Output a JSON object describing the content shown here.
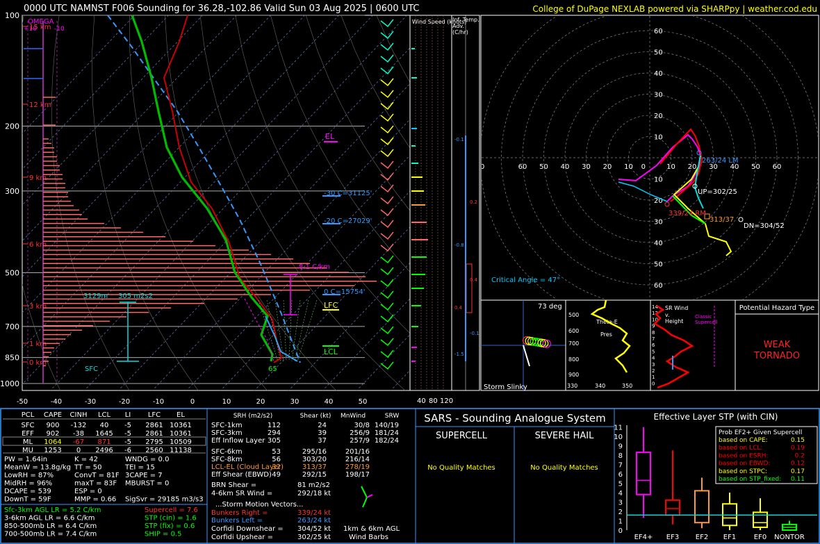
{
  "header": {
    "title": "0000 UTC NAMNST F006 Sounding for 36.28,-102.86 Valid  Sun 03 Aug 2025 | 0600 UTC",
    "credit": "College of DuPage NEXLAB powered via SHARPpy | weather.cod.edu"
  },
  "skewt": {
    "pressure_ticks": [
      "100",
      "200",
      "300",
      "500",
      "700",
      "850",
      "1000"
    ],
    "temp_ticks": [
      "-50",
      "-40",
      "-30",
      "-20",
      "-10",
      "0",
      "10",
      "20",
      "30",
      "40",
      "50"
    ],
    "height_labels": [
      "15 km",
      "12 km",
      "9 km",
      "6 km",
      "3 km",
      "1 km",
      "0 km"
    ],
    "omega_label": "OMEGA",
    "omega_left": "+10",
    "omega_right": "-10",
    "el_label": "EL",
    "lfc_label": "LFC",
    "lcl_label": "LCL",
    "lapse_label": "8.1 C/km",
    "m30_label": "-30 C=31125'",
    "m20_label": "-20 C=27029'",
    "zero_label": "0 C=15754'",
    "sfc_label": "SFC",
    "depth_label": "3129m",
    "srh_label": "305 m2s2",
    "sfc_value": "65",
    "omega_profile": [
      2,
      3,
      4,
      4,
      5,
      5,
      6,
      6,
      7,
      7,
      8,
      8,
      9,
      9,
      10,
      11,
      13,
      14,
      16,
      22,
      28,
      36,
      44,
      54,
      62,
      74,
      82,
      90,
      96,
      102,
      110,
      116,
      120,
      112,
      96,
      82,
      70,
      58,
      46,
      38,
      30,
      24,
      18,
      14,
      10,
      8,
      6,
      4,
      3,
      2,
      2,
      1
    ],
    "temp_profile": [
      [
        100,
        -5
      ],
      [
        150,
        -30
      ],
      [
        200,
        -26
      ],
      [
        250,
        -17
      ],
      [
        300,
        -8
      ],
      [
        350,
        -1
      ],
      [
        400,
        5
      ],
      [
        450,
        10
      ],
      [
        500,
        13
      ],
      [
        550,
        16
      ],
      [
        600,
        18
      ],
      [
        650,
        20
      ],
      [
        700,
        21
      ],
      [
        750,
        22
      ],
      [
        800,
        22
      ],
      [
        850,
        26
      ],
      [
        875,
        27
      ]
    ],
    "dew_profile": [
      [
        100,
        -25
      ],
      [
        150,
        -33
      ],
      [
        200,
        -32
      ],
      [
        250,
        -24
      ],
      [
        300,
        -14
      ],
      [
        350,
        -5
      ],
      [
        400,
        0
      ],
      [
        450,
        4
      ],
      [
        500,
        9
      ],
      [
        550,
        13
      ],
      [
        600,
        15
      ],
      [
        650,
        18
      ],
      [
        700,
        20
      ],
      [
        750,
        20
      ],
      [
        800,
        20
      ],
      [
        850,
        24
      ],
      [
        875,
        24
      ]
    ],
    "parcel_profile": [
      [
        875,
        27
      ],
      [
        800,
        24
      ],
      [
        700,
        20
      ],
      [
        600,
        15
      ],
      [
        500,
        6
      ],
      [
        400,
        -7
      ],
      [
        300,
        -20
      ],
      [
        250,
        -30
      ],
      [
        200,
        -36
      ],
      [
        150,
        -50
      ],
      [
        100,
        -70
      ]
    ]
  },
  "wind_speed_panel": {
    "title": "Wind Speed (knots)",
    "ticks": [
      "40",
      "80",
      "120"
    ]
  },
  "inferred_temp_panel": {
    "title": "Inf. Temp. Adv. (C/hr)",
    "values": [
      "-0.1",
      "0.2",
      "-0.8",
      "0.4",
      "0.4",
      "-0.1",
      "-1.5"
    ]
  },
  "hodograph": {
    "ring_labels": [
      "60",
      "50",
      "40",
      "30",
      "20",
      "10"
    ],
    "lm_label": "263/24 LM",
    "up_label": "UP=302/25",
    "rm_label": "339/24 RM",
    "mean_label": "313/37",
    "dn_label": "DN=304/52",
    "critical_angle": "Critical Angle = 47°"
  },
  "slinky": {
    "angle": "73 deg",
    "label": "Storm Slinky"
  },
  "theta": {
    "label1": "Theta-E",
    "label2": "Pres",
    "ticks": [
      "500",
      "600",
      "700",
      "800",
      "900"
    ],
    "xticks": [
      "330",
      "340",
      "350"
    ]
  },
  "srwind": {
    "title": "SR Wind v. Height",
    "classic": "Classic Supercell",
    "ticks": [
      "14",
      "12",
      "10",
      "9",
      "8",
      "7",
      "6",
      "5",
      "4",
      "3",
      "2",
      "1",
      "0"
    ]
  },
  "hazard": {
    "title": "Potential Hazard Type",
    "value_line1": "WEAK",
    "value_line2": "TORNADO"
  },
  "parcel_table": {
    "headers": [
      "PCL",
      "CAPE",
      "CINH",
      "LCL",
      "LI",
      "LFC",
      "EL"
    ],
    "rows": [
      [
        "SFC",
        "900",
        "-132",
        "40",
        "-5",
        "2861",
        "10361"
      ],
      [
        "EFF",
        "902",
        "-38",
        "1645",
        "-5",
        "2861",
        "10361"
      ],
      [
        "ML",
        "1064",
        "-67",
        "871",
        "-5",
        "2795",
        "10509"
      ],
      [
        "MU",
        "1253",
        "0",
        "2496",
        "-6",
        "2560",
        "11138"
      ]
    ]
  },
  "indices": {
    "col1": [
      "PW = 1.64in",
      "MeanW = 13.8g/kg",
      "LowRH = 87%",
      "MidRH = 96%",
      "DCAPE = 539",
      "DownT = 59F"
    ],
    "col2": [
      "K = 42",
      "TT = 50",
      "ConvT = 81F",
      "maxT = 83F",
      "ESP = 0",
      "MMP = 0.66"
    ],
    "col3": [
      "WNDG = 0.0",
      "TEI = 15",
      "3CAPE = 7",
      "MBURST = 0",
      "",
      "SigSvr = 29185 m3/s3"
    ]
  },
  "lapse_rates": {
    "left": [
      "Sfc-3km AGL LR = 5.2 C/km",
      "3-6km AGL LR = 6.6 C/km",
      "850-500mb LR = 6.4 C/km",
      "700-500mb LR = 7.4 C/km"
    ],
    "right": [
      "Supercell = 7.6",
      "STP (cin) = 1.6",
      "STP (fix) = 0.6",
      "SHIP = 0.5"
    ]
  },
  "kinematics": {
    "headers": [
      "SRH (m2/s2)",
      "Shear (kt)",
      "MnWind",
      "SRW"
    ],
    "rows": [
      [
        "SFC-1km",
        "112",
        "24",
        "30/8",
        "140/19"
      ],
      [
        "SFC-3km",
        "294",
        "39",
        "256/9",
        "181/24"
      ],
      [
        "Eff Inflow Layer",
        "305",
        "37",
        "257/9",
        "182/24"
      ],
      [
        "SFC-6km",
        "53",
        "295/16",
        "201/16",
        ""
      ],
      [
        "SFC-8km",
        "56",
        "303/20",
        "216/14",
        ""
      ],
      [
        "LCL-EL (Cloud Layer)",
        "32",
        "313/37",
        "278/19",
        ""
      ],
      [
        "Eff Shear (EBWD)",
        "49",
        "292/15",
        "198/17",
        ""
      ]
    ],
    "brn_shear": "BRN Shear =",
    "brn_value": "81 m2/s2",
    "sr_wind_46": "4-6km SR Wind =",
    "sr_wind_46_value": "292/18 kt",
    "storm_motion_title": "...Storm Motion Vectors...",
    "bunkers_right": "Bunkers Right =",
    "bunkers_right_value": "339/24 kt",
    "bunkers_left": "Bunkers Left =",
    "bunkers_left_value": "263/24 kt",
    "corfidi_down": "Corfidi Downshear =",
    "corfidi_down_value": "304/52 kt",
    "corfidi_up": "Corfidi Upshear =",
    "corfidi_up_value": "302/25 kt",
    "barbs_label1": "1km & 6km AGL",
    "barbs_label2": "Wind Barbs"
  },
  "sars": {
    "title": "SARS - Sounding Analogue System",
    "supercell": "SUPERCELL",
    "hail": "SEVERE HAIL",
    "supercell_match": "No Quality Matches",
    "hail_match": "No Quality Matches"
  },
  "stp_chart": {
    "title": "Effective Layer STP (with CIN)",
    "categories": [
      "EF4+",
      "EF3",
      "EF2",
      "EF1",
      "EF0",
      "NONTOR"
    ],
    "colors": [
      "#ff00ff",
      "#ff0000",
      "#ff9933",
      "#ffff00",
      "#ffff00",
      "#00ff00"
    ],
    "boxes": [
      {
        "lo": 1.3,
        "q1": 3.8,
        "med": 5.3,
        "q3": 8.3,
        "hi": 11.0
      },
      {
        "lo": 0.6,
        "q1": 1.6,
        "med": 2.3,
        "q3": 3.2,
        "hi": 8.5
      },
      {
        "lo": 0.2,
        "q1": 0.8,
        "med": 1.6,
        "q3": 4.2,
        "hi": 5.6
      },
      {
        "lo": 0.0,
        "q1": 0.5,
        "med": 1.3,
        "q3": 2.8,
        "hi": 4.0
      },
      {
        "lo": 0.0,
        "q1": 0.3,
        "med": 0.8,
        "q3": 1.9,
        "hi": 3.4
      },
      {
        "lo": 0.0,
        "q1": 0.0,
        "med": 0.3,
        "q3": 0.6,
        "hi": 1.0
      }
    ],
    "yticks": [
      "0",
      "1",
      "2",
      "3",
      "4",
      "5",
      "6",
      "7",
      "8",
      "9",
      "10",
      "11"
    ],
    "current_value": 1.6,
    "prob_title": "Prob EF2+ Given Supercell",
    "probs": [
      {
        "label": "based on CAPE:",
        "value": "0.15",
        "color": "#ffff00"
      },
      {
        "label": "based on LCL:",
        "value": "0.19",
        "color": "#ff0000"
      },
      {
        "label": "based on ESRH:",
        "value": "0.2",
        "color": "#ff0000"
      },
      {
        "label": "based on EBWD:",
        "value": "0.12",
        "color": "#ff0000"
      },
      {
        "label": "based on STPC:",
        "value": "0.17",
        "color": "#ffff00"
      },
      {
        "label": "based on STP_fixed:",
        "value": "0.11",
        "color": "#00ff00"
      }
    ]
  }
}
